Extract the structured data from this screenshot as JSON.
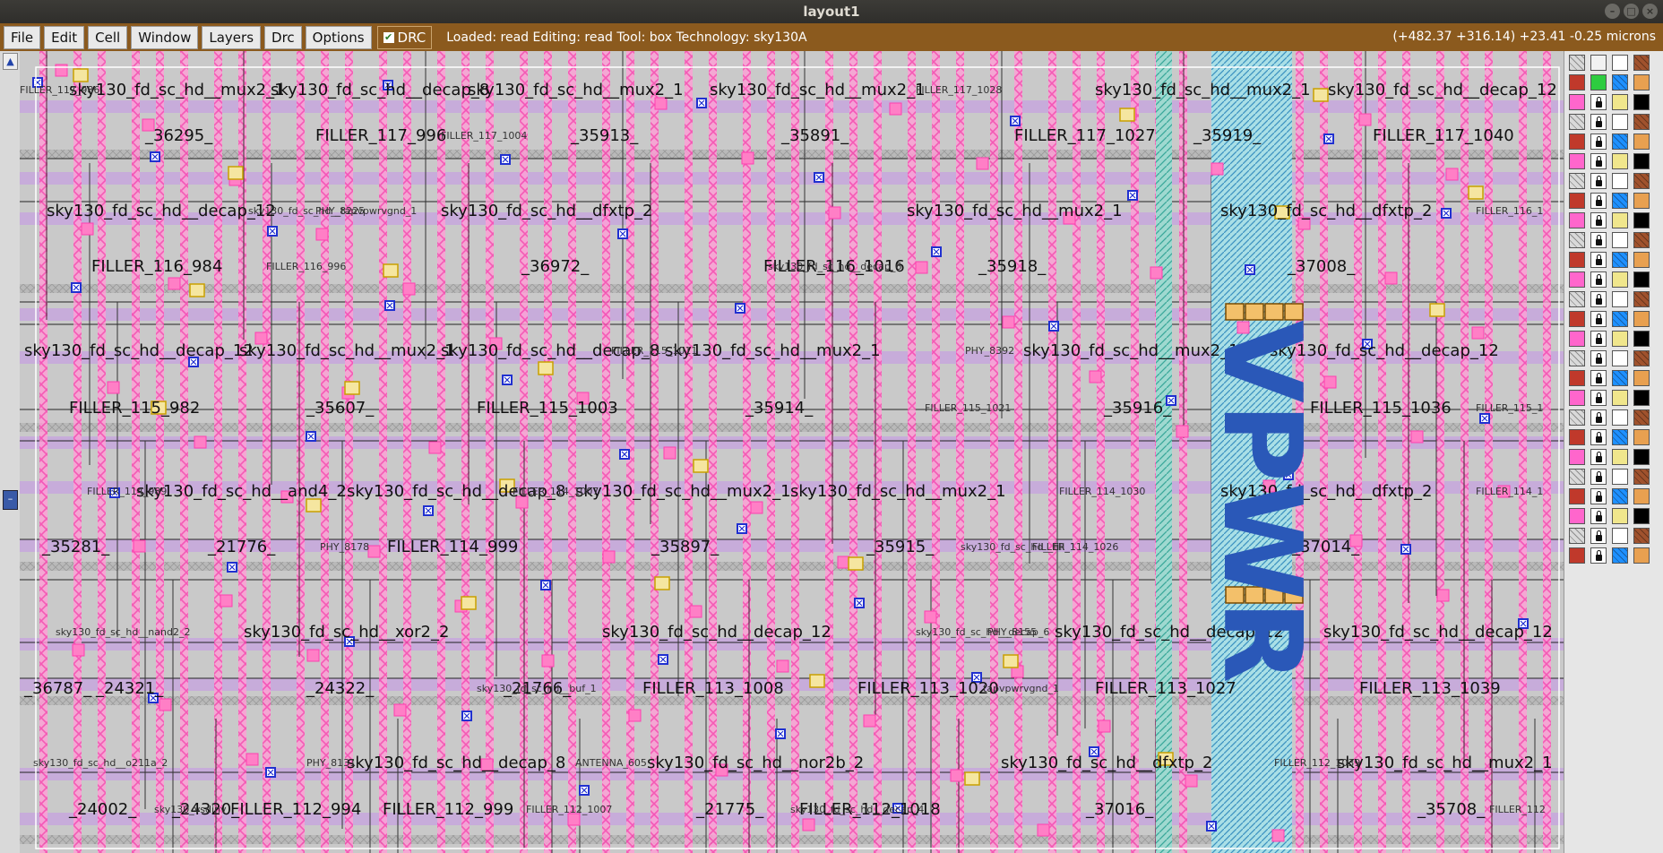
{
  "window": {
    "title": "layout1",
    "buttons": [
      "–",
      "□",
      "×"
    ]
  },
  "menu": {
    "items": [
      "File",
      "Edit",
      "Cell",
      "Window",
      "Layers",
      "Drc",
      "Options"
    ],
    "drc_label": "DRC",
    "drc_checked": true
  },
  "status": {
    "text": "Loaded: read Editing: read Tool: box  Technology: sky130A",
    "coords": "(+482.37 +316.14) +23.41 -0.25 microns"
  },
  "canvas": {
    "net_label": "VPWR",
    "rows": [
      {
        "cells": [
          "sky130_fd_sc_hd__mux2_1",
          "sky130_fd_sc_hd__decap_8",
          "sky130_fd_sc_hd__mux2_1",
          "sky130_fd_sc_hd__mux2_1",
          "sky130_fd_sc_hd__mux2_1",
          "sky130_fd_sc_hd__decap_12"
        ],
        "instances": [
          "_36295_",
          "FILLER_117_996",
          "_35913_",
          "_35891_",
          "FILLER_117_1027",
          "_35919_",
          "FILLER_117_1040"
        ],
        "small": [
          "FILLER_117_986",
          "FILLER_117_1004",
          "FILLER_117_1028"
        ]
      },
      {
        "cells": [
          "sky130_fd_sc_hd__decap_12",
          "sky130_fd_sc_hd__dfxtp_2",
          "sky130_fd_sc_hd__mux2_1",
          "sky130_fd_sc_hd__dfxtp_2"
        ],
        "instances": [
          "FILLER_116_984",
          "_36972_",
          "FILLER_116_1016",
          "_35918_",
          "_37008_"
        ],
        "small": [
          "sky130_fd_sc_hd__tapvpwrvgnd_1",
          "FILLER_116_996",
          "PHY_8225",
          "sky130_fd_sc_hd__decap_6",
          "FILLER_116_1"
        ]
      },
      {
        "cells": [
          "sky130_fd_sc_hd__decap_12",
          "sky130_fd_sc_hd__mux2_1",
          "sky130_fd_sc_hd__decap_8",
          "sky130_fd_sc_hd__mux2_1",
          "sky130_fd_sc_hd__mux2_1",
          "sky130_fd_sc_hd__decap_12"
        ],
        "instances": [
          "FILLER_115_982",
          "_35607_",
          "FILLER_115_1003",
          "_35914_",
          "_35916_",
          "FILLER_115_1036"
        ],
        "small": [
          "FILLER_115_1011",
          "FILLER_115_1021",
          "PHY_8392",
          "FILLER_115_1"
        ]
      },
      {
        "cells": [
          "sky130_fd_sc_hd__and4_2",
          "sky130_fd_sc_hd__decap_8",
          "sky130_fd_sc_hd__mux2_1",
          "sky130_fd_sc_hd__mux2_1",
          "sky130_fd_sc_hd__dfxtp_2"
        ],
        "instances": [
          "_35281_",
          "_21776_",
          "FILLER_114_999",
          "_35897_",
          "_35915_",
          "_37014_"
        ],
        "small": [
          "FILLER_114_989",
          "PHY_8178",
          "FILLER_114_1007",
          "FILLER_114_1026",
          "FILLER_114_1030",
          "sky130_fd_sc_hd__fill_1",
          "FILLER_114_1"
        ]
      },
      {
        "cells": [
          "sky130_fd_sc_hd__xor2_2",
          "sky130_fd_sc_hd__decap_12",
          "sky130_fd_sc_hd__decap_12",
          "sky130_fd_sc_hd__decap_12"
        ],
        "instances": [
          "_36787_",
          "_24321_",
          "_24322_",
          "_21766_",
          "FILLER_113_1008",
          "FILLER_113_1020",
          "FILLER_113_1027",
          "FILLER_113_1039"
        ],
        "small": [
          "sky130_fd_sc_hd__nand2_2",
          "sky130_fd_sc_hd__buf_1",
          "sky130_fd_sc_hd__decap_6",
          "tapvpwrvgnd_1",
          "PHY_8155"
        ]
      },
      {
        "cells": [
          "sky130_fd_sc_hd__decap_8",
          "sky130_fd_sc_hd__nor2b_2",
          "sky130_fd_sc_hd__dfxtp_2",
          "sky130_fd_sc_hd__mux2_1"
        ],
        "instances": [
          "_24002_",
          "_24320_",
          "FILLER_112_994",
          "FILLER_112_999",
          "_21775_",
          "FILLER_112_1018",
          "_37016_",
          "_35708_"
        ],
        "small": [
          "sky130_fd_sc_hd__o211a_2",
          "sky130_vsdinv",
          "PHY_8131",
          "FILLER_112_1007",
          "ANTENNA_605",
          "sky130_fd_sc_hd__decap_4",
          "FILLER_112_1039",
          "FILLER_112"
        ]
      }
    ]
  },
  "layer_palette": {
    "colors": [
      "#d9d9d9",
      "#f2f2f2",
      "#ffffff",
      "#a0522d",
      "#c0392b",
      "#2ecc40",
      "#1e90ff",
      "#e8a050",
      "#ff66cc",
      "#bb00ff",
      "#f0e68c",
      "#000000"
    ]
  }
}
